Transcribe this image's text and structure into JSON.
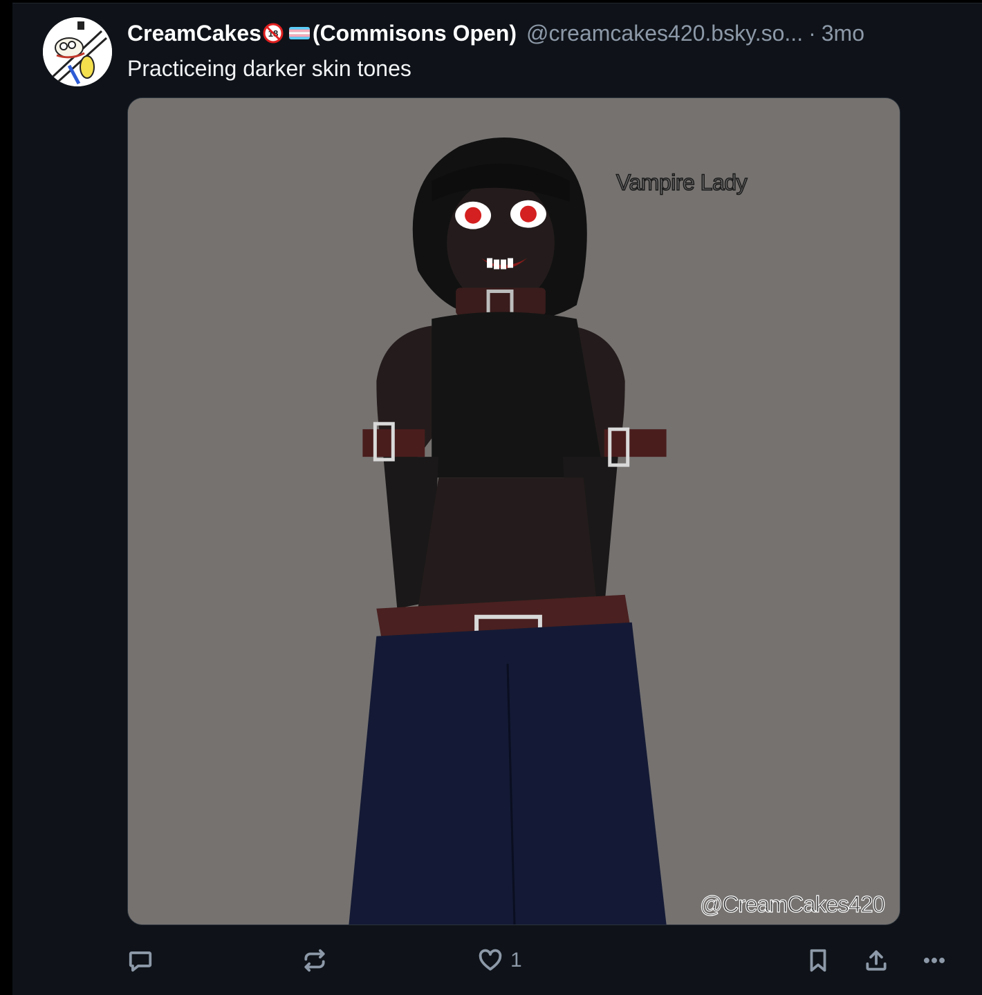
{
  "post": {
    "author": {
      "display_name": "CreamCakes",
      "status": "(Commisons Open)",
      "handle": "@creamcakes420.bsky.so...",
      "timestamp": "3mo"
    },
    "separator": "·",
    "text": "Practiceing darker skin tones",
    "image": {
      "label": "Vampire Lady",
      "watermark": "@CreamCakes420"
    },
    "actions": {
      "reply_icon": "reply-icon",
      "repost_icon": "repost-icon",
      "like_icon": "heart-icon",
      "like_count": "1",
      "bookmark_icon": "bookmark-icon",
      "share_icon": "share-icon",
      "more_icon": "more-icon"
    },
    "colors": {
      "background": "#0f1319",
      "muted_text": "#8d99a8",
      "image_bg": "#757270"
    }
  }
}
